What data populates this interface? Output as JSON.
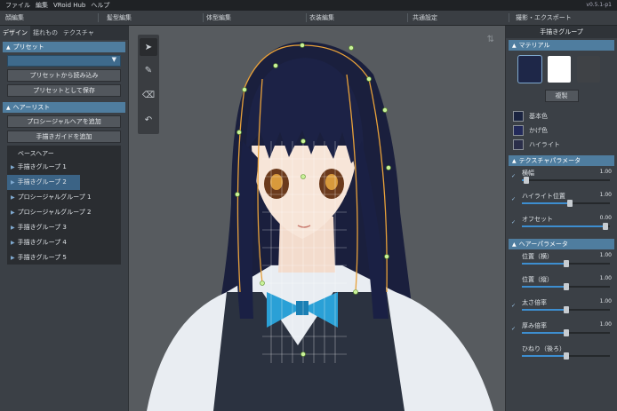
{
  "menu": [
    "ファイル",
    "編集",
    "VRoid Hub",
    "ヘルプ"
  ],
  "version": "v0.5.1-p1",
  "main_tabs": [
    "顔編集",
    "髪型編集",
    "体型編集",
    "衣装編集",
    "共通設定",
    "撮影・エクスポート"
  ],
  "left_panel": {
    "subtabs": [
      "デザイン",
      "揺れもの",
      "テクスチャ"
    ],
    "preset_header": "プリセット",
    "preset_load": "プリセットから読み込み",
    "preset_save": "プリセットとして保存",
    "hairlist_header": "ヘアーリスト",
    "add_procedural": "プロシージャルヘアを追加",
    "add_guide": "手描きガイドを追加",
    "tree": [
      {
        "label": "ベースヘアー",
        "kind": "base"
      },
      {
        "label": "手描きグループ 1",
        "kind": "group"
      },
      {
        "label": "手描きグループ 2",
        "kind": "group",
        "selected": true
      },
      {
        "label": "プロシージャルグループ 1",
        "kind": "group"
      },
      {
        "label": "プロシージャルグループ 2",
        "kind": "group"
      },
      {
        "label": "手描きグループ 3",
        "kind": "group"
      },
      {
        "label": "手描きグループ 4",
        "kind": "group"
      },
      {
        "label": "手描きグループ 5",
        "kind": "group"
      }
    ]
  },
  "tools": [
    "cursor-icon",
    "pen-icon",
    "eraser-icon",
    "undo-icon"
  ],
  "right_panel": {
    "title": "手描きグループ",
    "material_header": "マテリアル",
    "duplicate": "複製",
    "colors": [
      {
        "label": "基本色",
        "color": "#1b2440"
      },
      {
        "label": "かげ色",
        "color": "#232a5a"
      },
      {
        "label": "ハイライト",
        "color": "#2b2f4a"
      }
    ],
    "swatches": [
      "#1e2748",
      "#ffffff",
      "#3f4246"
    ],
    "texture_header": "テクスチャパラメータ",
    "texture_params": [
      {
        "label": "横幅",
        "value": "1.00",
        "fill": 0.05,
        "checked": true
      },
      {
        "label": "ハイライト位置",
        "value": "1.00",
        "fill": 0.55,
        "checked": true
      },
      {
        "label": "オフセット",
        "value": "0.00",
        "fill": 0.95,
        "checked": true
      }
    ],
    "hair_header": "ヘアーパラメータ",
    "hair_params": [
      {
        "label": "位置（横）",
        "value": "1.00",
        "fill": 0.5,
        "checked": false
      },
      {
        "label": "位置（縦）",
        "value": "1.00",
        "fill": 0.5,
        "checked": false
      },
      {
        "label": "太さ倍率",
        "value": "1.00",
        "fill": 0.5,
        "checked": true
      },
      {
        "label": "厚み倍率",
        "value": "1.00",
        "fill": 0.5,
        "checked": true
      },
      {
        "label": "ひねり（後ろ）",
        "value": "",
        "fill": 0.5,
        "checked": false
      }
    ]
  }
}
